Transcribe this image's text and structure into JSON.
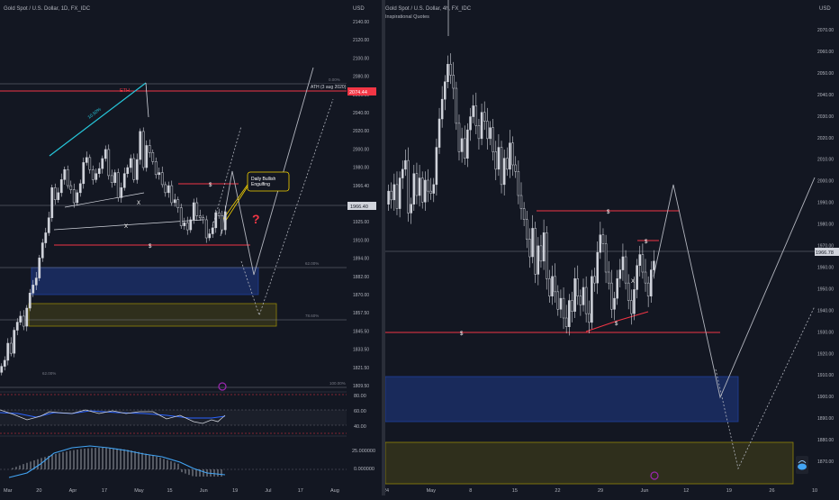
{
  "colors": {
    "background": "#131722",
    "axis_text": "#b2b5be",
    "candle": "#d1d4dc",
    "red": "#f23645",
    "cyan": "#26c6da",
    "blue_zone": "#1e3a8a",
    "olive_zone": "#3b3a1a",
    "yellow": "#f5d300",
    "purple": "#9c27b0"
  },
  "chart_data": [
    {
      "type": "candlestick",
      "title": "Gold Spot / U.S. Dollar, 1D, FX_IDC",
      "currency": "USD",
      "y_ticks": [
        "2140.00",
        "2120.00",
        "2100.00",
        "2080.00",
        "2060.00",
        "2040.00",
        "2020.00",
        "2000.00",
        "1980.00",
        "1966.40",
        "1940.00",
        "1925.00",
        "1910.00",
        "1894.00",
        "1882.00",
        "1870.00",
        "1857.50",
        "1845.50",
        "1833.50",
        "1821.50",
        "1809.50"
      ],
      "ylim": [
        1800,
        2150
      ],
      "x_ticks": [
        "Mar",
        "20",
        "Apr",
        "17",
        "May",
        "15",
        "Jun",
        "19",
        "Jul",
        "17",
        "Aug"
      ],
      "price_label": "1966.40",
      "ath_label": "ATH (3 aug 2020)",
      "ath_price": "2074.44",
      "fib_labels": [
        "62.00%",
        "78.60%",
        "62.00%",
        "100.00%"
      ],
      "labels": {
        "eth": "ETH",
        "trend": "10.50%",
        "s1": "$",
        "s2": "$",
        "x1": "X",
        "x2": "X",
        "question": "?",
        "zero_fib": "0.00%"
      },
      "callout": [
        "Daily Bullish",
        "Engulfing"
      ],
      "rsi_ticks": [
        "80.00",
        "60.00",
        "40.00"
      ],
      "osc_ticks": [
        "25.000000",
        "0.000000"
      ],
      "close_series": [
        1812,
        1818,
        1835,
        1825,
        1848,
        1856,
        1862,
        1852,
        1870,
        1885,
        1893,
        1900,
        1920,
        1935,
        1945,
        1960,
        1990,
        1978,
        1985,
        1998,
        2008,
        1992,
        1988,
        1975,
        1985,
        1994,
        2015,
        2020,
        2008,
        1998,
        2004,
        2009,
        2019,
        2028,
        2002,
        1995,
        2005,
        1980,
        1990,
        2004,
        2010,
        2019,
        1998,
        2018,
        2046,
        2010,
        2032,
        2025,
        2016,
        2003,
        2005,
        1993,
        1985,
        1992,
        1975,
        1978,
        1970,
        1952,
        1955,
        1948,
        1958,
        1975,
        1962,
        1960,
        1958,
        1940,
        1944,
        1950,
        1965,
        1962,
        1948,
        1966
      ]
    },
    {
      "type": "candlestick",
      "title": "Gold Spot / U.S. Dollar, 4h, FX_IDC",
      "subtitle": "Inspirational Quotes",
      "currency": "USD",
      "y_ticks": [
        "2070.00",
        "2060.00",
        "2050.00",
        "2040.00",
        "2030.00",
        "2020.00",
        "2010.00",
        "2000.00",
        "1990.00",
        "1980.00",
        "1970.00",
        "1960.00",
        "1950.00",
        "1940.00",
        "1930.00",
        "1920.00",
        "1910.00",
        "1900.00",
        "1890.00",
        "1880.00",
        "1870.00"
      ],
      "ylim": [
        1865,
        2075
      ],
      "x_ticks": [
        "24",
        "May",
        "8",
        "15",
        "22",
        "29",
        "Jun",
        "12",
        "19",
        "26",
        "10"
      ],
      "price_label": "1966.78",
      "labels": {
        "s1": "$",
        "s2": "$",
        "s3": "$",
        "s4": "$",
        "x1": "X"
      },
      "close_series": [
        2000,
        1996,
        2003,
        1992,
        2006,
        2010,
        2014,
        1990,
        1994,
        2008,
        1998,
        2006,
        1995,
        2005,
        2000,
        1999,
        2003,
        2020,
        2033,
        2042,
        2050,
        2058,
        2053,
        2047,
        2031,
        2018,
        2024,
        2015,
        2028,
        2034,
        2039,
        2030,
        2024,
        2036,
        2032,
        2024,
        2029,
        2018,
        2010,
        2020,
        2003,
        2015,
        2010,
        2022,
        2012,
        2009,
        1998,
        1992,
        1987,
        1978,
        1970,
        1983,
        1962,
        1975,
        1968,
        1981,
        1960,
        1952,
        1961,
        1954,
        1946,
        1951,
        1942,
        1938,
        1950,
        1945,
        1960,
        1952,
        1948,
        1956,
        1944,
        1940,
        1961,
        1958,
        1972,
        1980,
        1976,
        1963,
        1958,
        1946,
        1951,
        1960,
        1964,
        1970,
        1958,
        1950,
        1944,
        1955,
        1966,
        1971,
        1963,
        1958,
        1952,
        1964,
        1968
      ]
    }
  ]
}
